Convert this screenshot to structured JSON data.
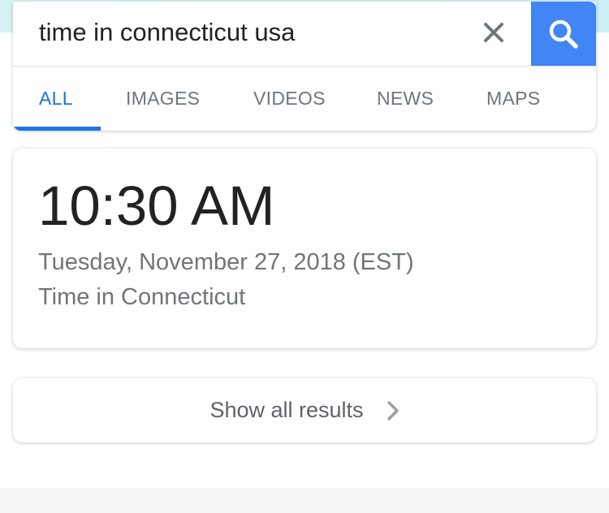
{
  "search": {
    "query": "time in connecticut usa",
    "clear_icon": "close-icon",
    "search_icon": "search-icon",
    "accent_color": "#4285f4"
  },
  "tabs": [
    {
      "label": "ALL",
      "active": true
    },
    {
      "label": "IMAGES",
      "active": false
    },
    {
      "label": "VIDEOS",
      "active": false
    },
    {
      "label": "NEWS",
      "active": false
    },
    {
      "label": "MAPS",
      "active": false
    }
  ],
  "time_card": {
    "time": "10:30 AM",
    "date": "Tuesday, November 27, 2018 (EST)",
    "location": "Time in Connecticut"
  },
  "results": {
    "label": "Show all results",
    "icon": "chevron-right-icon"
  }
}
